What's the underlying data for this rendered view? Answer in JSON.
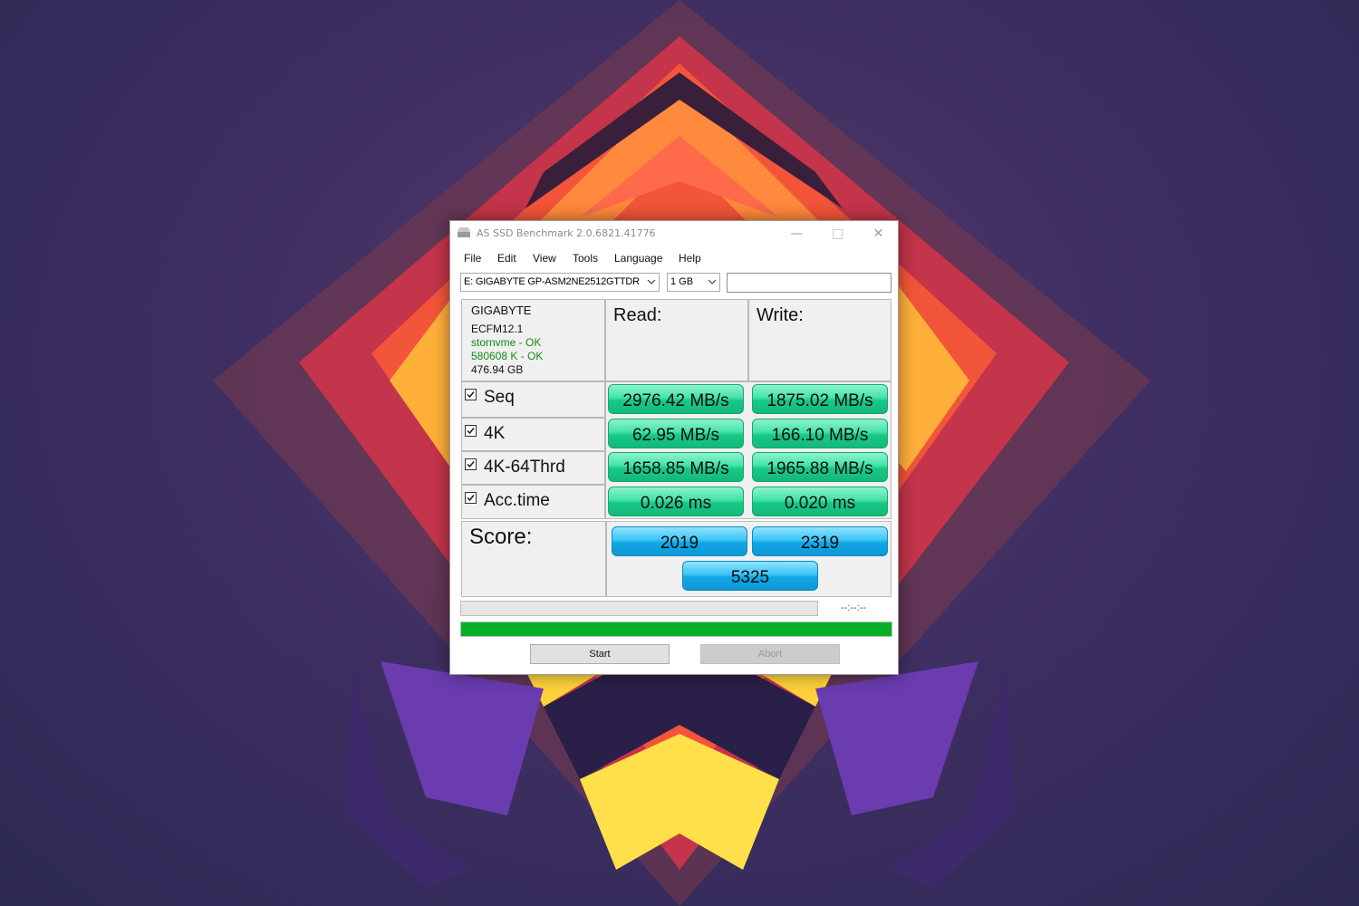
{
  "window": {
    "title": "AS SSD Benchmark 2.0.6821.41776",
    "controls": {
      "minimize": "—",
      "close": "✕"
    }
  },
  "menu": [
    "File",
    "Edit",
    "View",
    "Tools",
    "Language",
    "Help"
  ],
  "toolbar": {
    "drive": "E: GIGABYTE GP-ASM2NE2512GTTDR",
    "size": "1 GB",
    "text_field_value": ""
  },
  "drive_info": {
    "vendor": "GIGABYTE",
    "firmware": "ECFM12.1",
    "driver_status": "stornvme - OK",
    "alignment_status": "580608 K - OK",
    "capacity": "476.94 GB"
  },
  "headers": {
    "read": "Read:",
    "write": "Write:"
  },
  "tests": [
    {
      "label": "Seq",
      "checked": true,
      "read": "2976.42 MB/s",
      "write": "1875.02 MB/s"
    },
    {
      "label": "4K",
      "checked": true,
      "read": "62.95 MB/s",
      "write": "166.10 MB/s"
    },
    {
      "label": "4K-64Thrd",
      "checked": true,
      "read": "1658.85 MB/s",
      "write": "1965.88 MB/s"
    },
    {
      "label": "Acc.time",
      "checked": true,
      "read": "0.026 ms",
      "write": "0.020 ms"
    }
  ],
  "score": {
    "label": "Score:",
    "read": "2019",
    "write": "2319",
    "total": "5325"
  },
  "progress": {
    "time": "--:--:--",
    "overall_percent": 100
  },
  "buttons": {
    "start": "Start",
    "abort": "Abort"
  },
  "colors": {
    "result_green": "#2fd99a",
    "score_blue": "#1ab2ec",
    "progress_green": "#06b025"
  }
}
